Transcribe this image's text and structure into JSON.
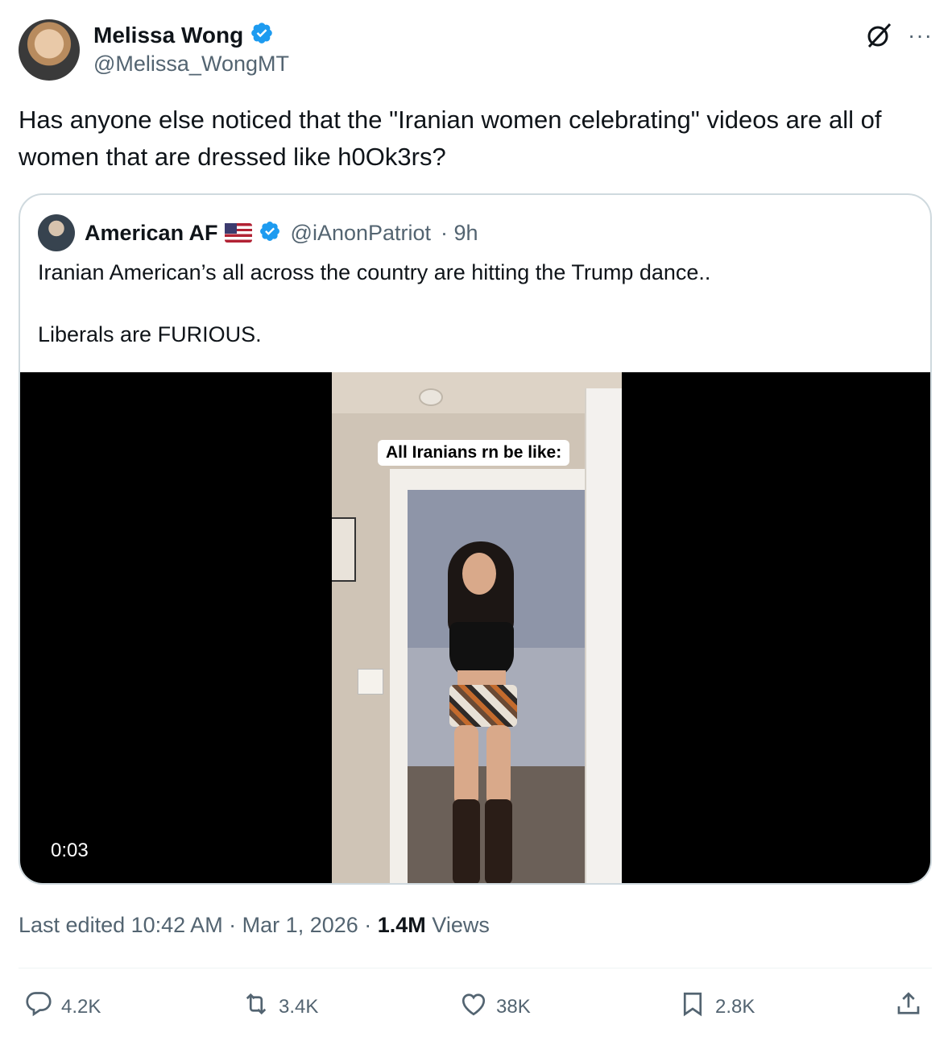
{
  "author": {
    "name": "Melissa Wong",
    "handle": "@Melissa_WongMT"
  },
  "tweet": {
    "text": "Has anyone else noticed that the \"Iranian women celebrating\" videos are all of women that are dressed like h0Ok3rs?"
  },
  "quoted": {
    "name": "American AF",
    "handle": "@iAnonPatriot",
    "time": "· 9h",
    "line1": "Iranian American’s all across the country are hitting the Trump dance..",
    "line2": "Liberals are FURIOUS.",
    "video_caption": "All Iranians rn be like:",
    "video_duration": "0:03"
  },
  "meta": {
    "edited": "Last edited 10:42 AM · Mar 1, 2026 · ",
    "views_count": "1.4M",
    "views_label": " Views"
  },
  "actions": {
    "replies": "4.2K",
    "reposts": "3.4K",
    "likes": "38K",
    "bookmarks": "2.8K"
  },
  "colors": {
    "verified": "#1d9bf0",
    "secondary_text": "#536471",
    "border": "#cfd9de"
  }
}
